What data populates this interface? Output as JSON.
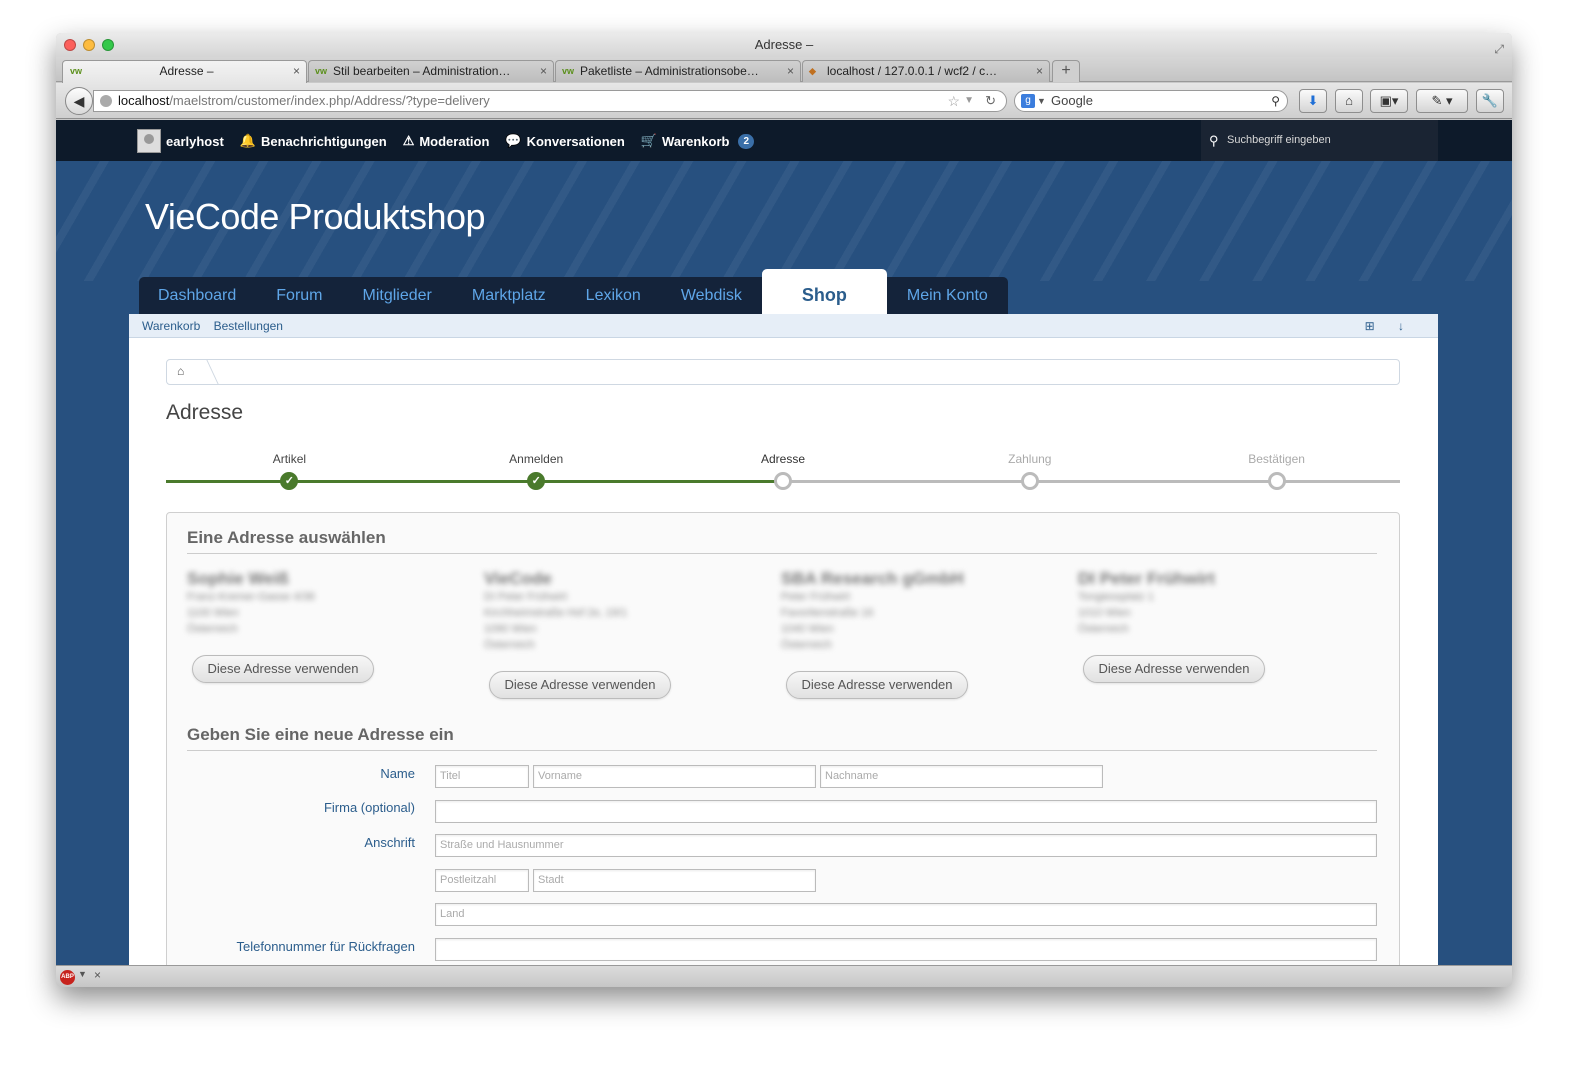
{
  "window": {
    "title": "Adresse –"
  },
  "tabs": [
    {
      "label": "Adresse –",
      "active": true
    },
    {
      "label": "Stil bearbeiten – Administration…",
      "active": false
    },
    {
      "label": "Paketliste – Administrationsobe…",
      "active": false
    },
    {
      "label": "localhost / 127.0.0.1 / wcf2 / c…",
      "active": false
    }
  ],
  "url": {
    "host": "localhost",
    "path": "/maelstrom/customer/index.php/Address/?type=delivery"
  },
  "search_engine": {
    "label": "Google"
  },
  "userbar": {
    "username": "earlyhost",
    "notifications": "Benachrichtigungen",
    "moderation": "Moderation",
    "conversations": "Konversationen",
    "cart": "Warenkorb",
    "cart_count": "2",
    "search_placeholder": "Suchbegriff eingeben"
  },
  "site": {
    "logo": "VieCode Produktshop"
  },
  "mainnav": [
    "Dashboard",
    "Forum",
    "Mitglieder",
    "Marktplatz",
    "Lexikon",
    "Webdisk",
    "Shop",
    "Mein Konto"
  ],
  "mainnav_active": "Shop",
  "subnav": [
    "Warenkorb",
    "Bestellungen"
  ],
  "page": {
    "title": "Adresse"
  },
  "progress": {
    "steps": [
      {
        "label": "Artikel",
        "state": "done"
      },
      {
        "label": "Anmelden",
        "state": "done"
      },
      {
        "label": "Adresse",
        "state": "current"
      },
      {
        "label": "Zahlung",
        "state": "todo"
      },
      {
        "label": "Bestätigen",
        "state": "todo"
      }
    ],
    "done_color": "#4a7a2c",
    "todo_color": "#bbbbbb"
  },
  "select_section": {
    "title": "Eine Adresse auswählen",
    "use_button": "Diese Adresse verwenden",
    "addresses": [
      {
        "name": "Sophie Weiß",
        "lines": [
          "Franz-Kremer-Gasse 4/38",
          "1100 Wien",
          "Österreich"
        ]
      },
      {
        "name": "VieCode",
        "lines": [
          "DI Peter Frühwirt",
          "Kirchheimstraße Hof 2e, 19/1",
          "1090 Wien",
          "Österreich"
        ]
      },
      {
        "name": "SBA Research gGmbH",
        "lines": [
          "Peter Frühwirt",
          "Favoritenstraße 16",
          "1040 Wien",
          "Österreich"
        ]
      },
      {
        "name": "DI Peter Frühwirt",
        "lines": [
          "Tongiessplatz 1",
          "1010 Wien",
          "Österreich"
        ]
      }
    ]
  },
  "new_section": {
    "title": "Geben Sie eine neue Adresse ein",
    "name_label": "Name",
    "company_label": "Firma (optional)",
    "address_label": "Anschrift",
    "phone_label": "Telefonnummer für Rückfragen",
    "ph_title": "Titel",
    "ph_firstname": "Vorname",
    "ph_lastname": "Nachname",
    "ph_street": "Straße und Hausnummer",
    "ph_zip": "Postleitzahl",
    "ph_city": "Stadt",
    "ph_country": "Land"
  }
}
